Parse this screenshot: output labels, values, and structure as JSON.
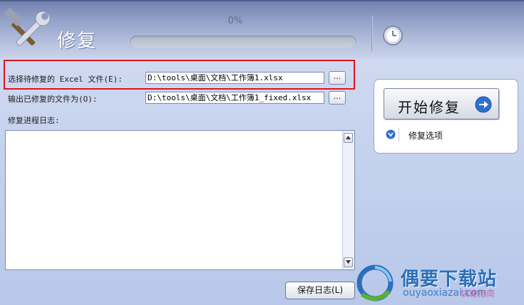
{
  "header": {
    "title": "修复",
    "progress_text": "0%",
    "progress_fraction": 0
  },
  "form": {
    "input_label": "选择待修复的 Excel 文件(E):",
    "input_value": "D:\\tools\\桌面\\文档\\工作簿1.xlsx",
    "output_label": "输出已修复的文件为(O):",
    "output_value": "D:\\tools\\桌面\\文档\\工作簿1_fixed.xlsx",
    "browse_label": "...",
    "log_label": "修复进程日志:",
    "log_content": ""
  },
  "actions": {
    "save_log_label": "保存日志(L)",
    "start_label": "开始修复",
    "options_label": "修复选项"
  },
  "watermark": {
    "name": "偶要下载站",
    "domain": "ouyaoxiazai.com",
    "slogan": "快速指南"
  },
  "colors": {
    "highlight": "#e0141e",
    "accent_blue": "#2f6fd0"
  }
}
